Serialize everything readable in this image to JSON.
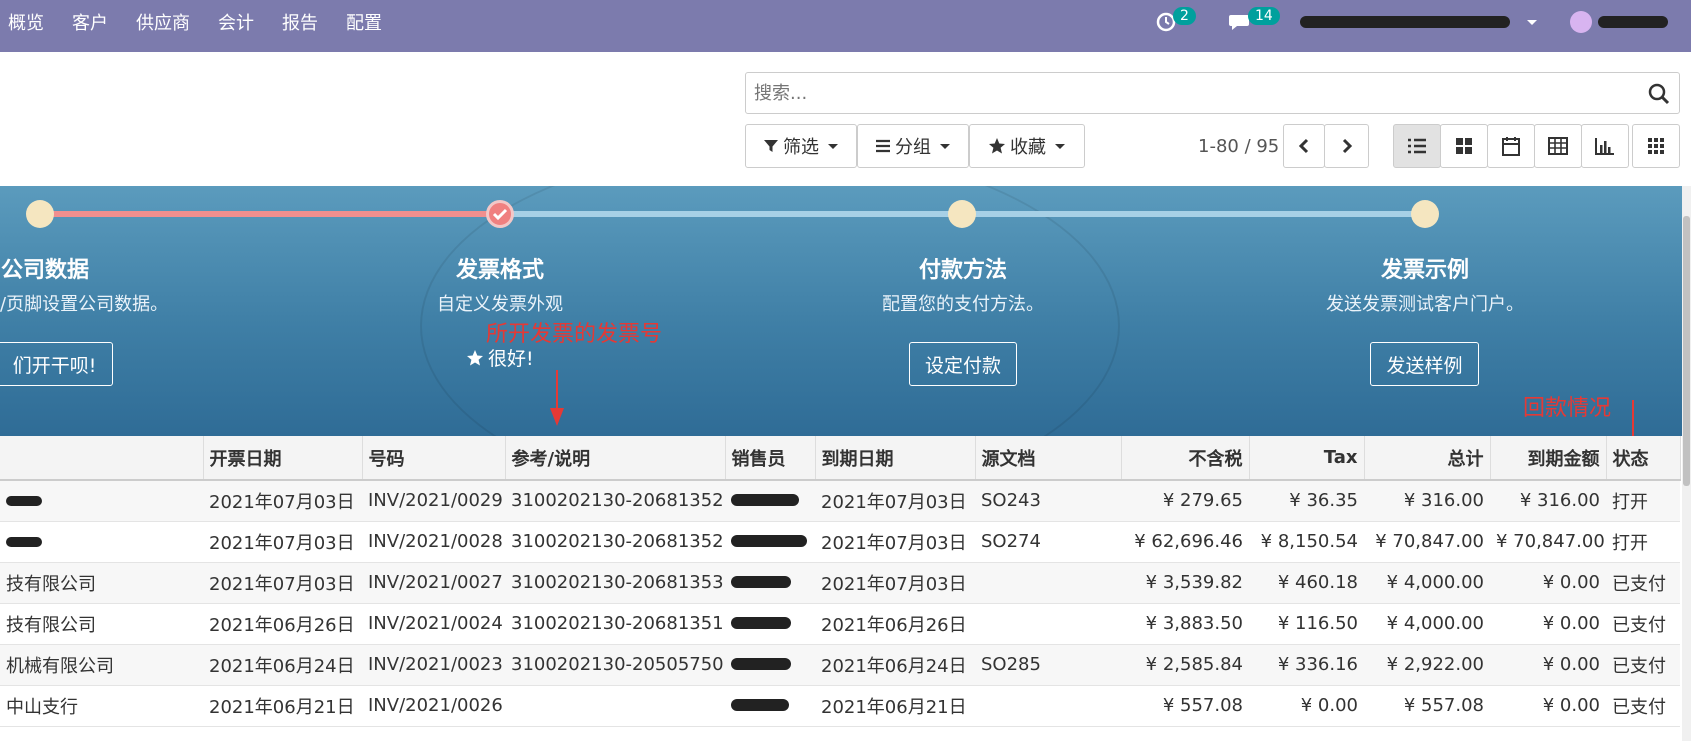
{
  "menu": [
    "概览",
    "客户",
    "供应商",
    "会计",
    "报告",
    "配置"
  ],
  "systray": {
    "activity_count": "2",
    "message_count": "14"
  },
  "search": {
    "placeholder": "搜索..."
  },
  "filters": {
    "filter": "筛选",
    "group": "分组",
    "favorites": "收藏"
  },
  "pager": "1-80 / 95",
  "views": [
    "list-view-icon",
    "kanban-view-icon",
    "calendar-view-icon",
    "pivot-view-icon",
    "graph-view-icon",
    "grid-view-icon"
  ],
  "onboarding": {
    "steps": [
      {
        "title": "公司数据",
        "subtitle": "/页脚设置公司数据。",
        "button": "们开干呗!"
      },
      {
        "title": "发票格式",
        "subtitle": "自定义发票外观",
        "done_label": "很好!"
      },
      {
        "title": "付款方法",
        "subtitle": "配置您的支付方法。",
        "button": "设定付款"
      },
      {
        "title": "发票示例",
        "subtitle": "发送发票测试客户门户。",
        "button": "发送样例"
      }
    ]
  },
  "annotations": {
    "invoice_number": "所开发票的发票号",
    "payment_status": "回款情况"
  },
  "table": {
    "headers": [
      "",
      "开票日期",
      "号码",
      "参考/说明",
      "销售员",
      "到期日期",
      "源文档",
      "不含税",
      "Tax",
      "总计",
      "到期金额",
      "状态"
    ],
    "rows": [
      {
        "partner": "",
        "date": "2021年07月03日",
        "number": "INV/2021/0029",
        "ref": "3100202130-20681352",
        "due": "2021年07月03日",
        "origin": "SO243",
        "untaxed": "¥ 279.65",
        "tax": "¥ 36.35",
        "total": "¥ 316.00",
        "residual": "¥ 316.00",
        "state": "打开"
      },
      {
        "partner": "",
        "date": "2021年07月03日",
        "number": "INV/2021/0028",
        "ref": "3100202130-20681352",
        "due": "2021年07月03日",
        "origin": "SO274",
        "untaxed": "¥ 62,696.46",
        "tax": "¥ 8,150.54",
        "total": "¥ 70,847.00",
        "residual": "¥ 70,847.00",
        "state": "打开"
      },
      {
        "partner": "技有限公司",
        "date": "2021年07月03日",
        "number": "INV/2021/0027",
        "ref": "3100202130-20681353",
        "due": "2021年07月03日",
        "origin": "",
        "untaxed": "¥ 3,539.82",
        "tax": "¥ 460.18",
        "total": "¥ 4,000.00",
        "residual": "¥ 0.00",
        "state": "已支付"
      },
      {
        "partner": "技有限公司",
        "date": "2021年06月26日",
        "number": "INV/2021/0024",
        "ref": "3100202130-20681351",
        "due": "2021年06月26日",
        "origin": "",
        "untaxed": "¥ 3,883.50",
        "tax": "¥ 116.50",
        "total": "¥ 4,000.00",
        "residual": "¥ 0.00",
        "state": "已支付"
      },
      {
        "partner": "机械有限公司",
        "date": "2021年06月24日",
        "number": "INV/2021/0023",
        "ref": "3100202130-20505750",
        "due": "2021年06月24日",
        "origin": "SO285",
        "untaxed": "¥ 2,585.84",
        "tax": "¥ 336.16",
        "total": "¥ 2,922.00",
        "residual": "¥ 0.00",
        "state": "已支付"
      },
      {
        "partner": "中山支行",
        "date": "2021年06月21日",
        "number": "INV/2021/0026",
        "ref": "",
        "due": "2021年06月21日",
        "origin": "",
        "untaxed": "¥ 557.08",
        "tax": "¥ 0.00",
        "total": "¥ 557.08",
        "residual": "¥ 0.00",
        "state": "已支付"
      }
    ]
  }
}
